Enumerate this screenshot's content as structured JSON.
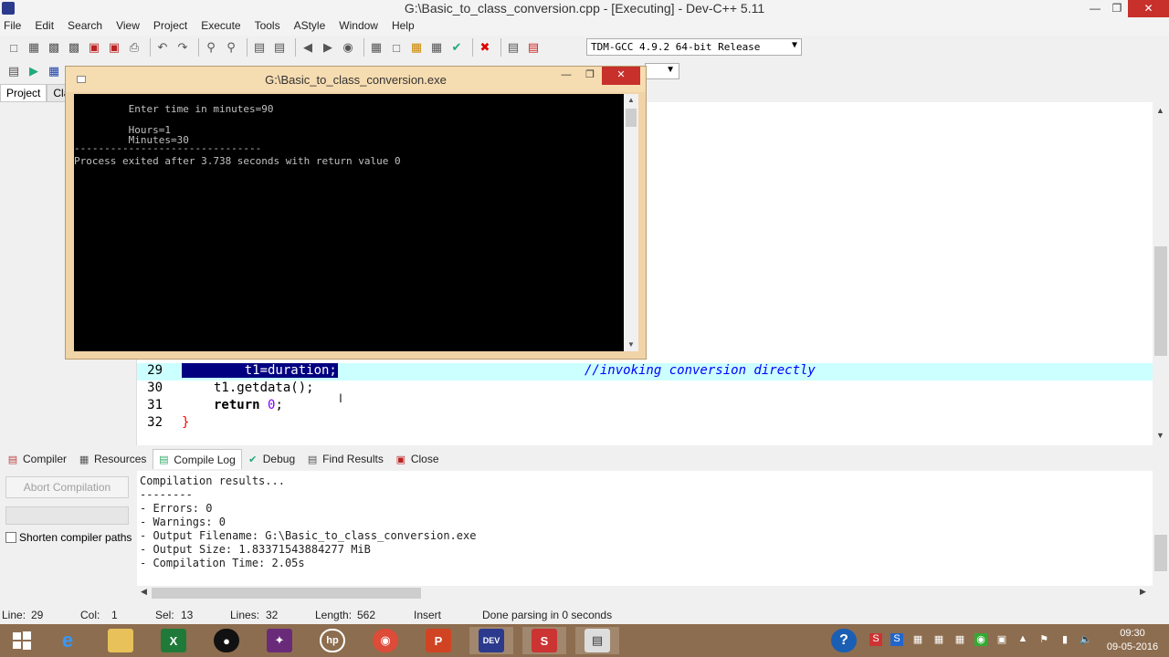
{
  "window": {
    "title": "G:\\Basic_to_class_conversion.cpp - [Executing] - Dev-C++ 5.11",
    "minimize": "—",
    "maximize": "❐",
    "close": "✕"
  },
  "menu": [
    "File",
    "Edit",
    "Search",
    "View",
    "Project",
    "Execute",
    "Tools",
    "AStyle",
    "Window",
    "Help"
  ],
  "toolbar": {
    "compiler": "TDM-GCC 4.9.2 64-bit Release"
  },
  "project_tabs": [
    "Project",
    "Clas"
  ],
  "console": {
    "title": "G:\\Basic_to_class_conversion.exe",
    "lines": [
      "         Enter time in minutes=90",
      "",
      "         Hours=1",
      "         Minutes=30",
      "-------------------------------",
      "Process exited after 3.738 seconds with return value 0"
    ]
  },
  "editor": {
    "lines": [
      {
        "num": "29",
        "code": "    t1=duration;",
        "comment": "//invoking conversion directly",
        "selected": true
      },
      {
        "num": "30",
        "code": "t1.getdata();"
      },
      {
        "num": "31",
        "kw": "return",
        "rest": " ",
        "numval": "0",
        "tail": ";"
      },
      {
        "num": "32",
        "brace": "}"
      }
    ]
  },
  "bottom_tabs": [
    {
      "label": "Compiler",
      "icon": "compiler-icon"
    },
    {
      "label": "Resources",
      "icon": "resources-icon"
    },
    {
      "label": "Compile Log",
      "icon": "compile-log-icon"
    },
    {
      "label": "Debug",
      "icon": "debug-icon"
    },
    {
      "label": "Find Results",
      "icon": "find-results-icon"
    },
    {
      "label": "Close",
      "icon": "close-icon"
    }
  ],
  "compile_panel": {
    "abort_label": "Abort Compilation",
    "shorten_label": "Shorten compiler paths",
    "log": [
      "Compilation results...",
      "--------",
      "- Errors: 0",
      "- Warnings: 0",
      "- Output Filename: G:\\Basic_to_class_conversion.exe",
      "- Output Size: 1.83371543884277 MiB",
      "- Compilation Time: 2.05s"
    ]
  },
  "status": {
    "line_label": "Line:",
    "line": "29",
    "col_label": "Col:",
    "col": "1",
    "sel_label": "Sel:",
    "sel": "13",
    "lines_label": "Lines:",
    "lines": "32",
    "length_label": "Length:",
    "length": "562",
    "mode": "Insert",
    "message": "Done parsing in 0 seconds"
  },
  "taskbar": {
    "clock_time": "09:30",
    "clock_date": "09-05-2016"
  },
  "colors": {
    "taskbar": "#8d6d4f",
    "selection": "#000080",
    "active_line": "#ccffff",
    "comment": "#0000ff",
    "close_red": "#c7302b"
  }
}
